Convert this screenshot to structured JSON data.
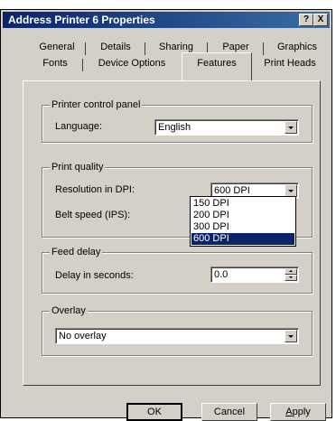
{
  "window": {
    "title": "Address Printer 6 Properties"
  },
  "titlebar_buttons": {
    "help": "?",
    "close": "X"
  },
  "tabs_row1": [
    {
      "label": "General"
    },
    {
      "label": "Details"
    },
    {
      "label": "Sharing"
    },
    {
      "label": "Paper"
    },
    {
      "label": "Graphics"
    }
  ],
  "tabs_row2": [
    {
      "label": "Fonts"
    },
    {
      "label": "Device Options"
    },
    {
      "label": "Features"
    },
    {
      "label": "Print Heads"
    }
  ],
  "active_tab": "Features",
  "printer_control_panel": {
    "legend": "Printer control panel",
    "language_label": "Language:",
    "language_value": "English"
  },
  "print_quality": {
    "legend": "Print quality",
    "resolution_label": "Resolution in DPI:",
    "resolution_value": "600 DPI",
    "resolution_options": [
      "150 DPI",
      "200 DPI",
      "300 DPI",
      "600 DPI"
    ],
    "belt_speed_label": "Belt speed (IPS):"
  },
  "feed_delay": {
    "legend": "Feed delay",
    "delay_label": "Delay in seconds:",
    "delay_value": "0.0"
  },
  "overlay": {
    "legend": "Overlay",
    "value": "No overlay"
  },
  "buttons": {
    "ok": "OK",
    "cancel": "Cancel",
    "apply": "Apply"
  },
  "colors": {
    "face": "#d4d0c8",
    "title_start": "#0a246a",
    "title_end": "#3a6ea5",
    "highlight": "#0a246a"
  }
}
